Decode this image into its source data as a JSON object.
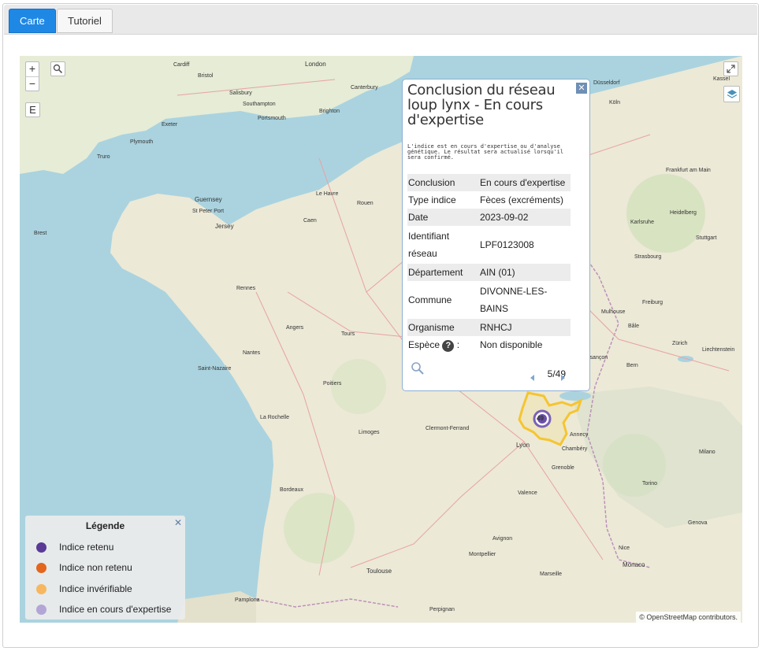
{
  "tabs": [
    {
      "label": "Carte",
      "active": true
    },
    {
      "label": "Tutoriel",
      "active": false
    }
  ],
  "map": {
    "controls": {
      "zoom_in": "+",
      "zoom_out": "−",
      "edit_label": "E"
    },
    "attribution": "© OpenStreetMap contributors.",
    "cluster_count": "49",
    "cities": [
      {
        "name": "London"
      },
      {
        "name": "Cardiff"
      },
      {
        "name": "Bristol"
      },
      {
        "name": "Salisbury"
      },
      {
        "name": "Southampton"
      },
      {
        "name": "Portsmouth"
      },
      {
        "name": "Canterbury"
      },
      {
        "name": "Brighton"
      },
      {
        "name": "Exeter"
      },
      {
        "name": "Plymouth"
      },
      {
        "name": "Truro"
      },
      {
        "name": "Guernsey"
      },
      {
        "name": "St Peter Port"
      },
      {
        "name": "Jersey"
      },
      {
        "name": "Rouen"
      },
      {
        "name": "Caen"
      },
      {
        "name": "Le Havre"
      },
      {
        "name": "Rennes"
      },
      {
        "name": "Nantes"
      },
      {
        "name": "Angers"
      },
      {
        "name": "Tours"
      },
      {
        "name": "Poitiers"
      },
      {
        "name": "La Rochelle"
      },
      {
        "name": "Bordeaux"
      },
      {
        "name": "Limoges"
      },
      {
        "name": "Clermont-Ferrand"
      },
      {
        "name": "Lyon"
      },
      {
        "name": "Grenoble"
      },
      {
        "name": "Toulouse"
      },
      {
        "name": "Montpellier"
      },
      {
        "name": "Marseille"
      },
      {
        "name": "Nice"
      },
      {
        "name": "Monaco"
      },
      {
        "name": "Genova"
      },
      {
        "name": "Milano"
      },
      {
        "name": "Torino"
      },
      {
        "name": "Zürich"
      },
      {
        "name": "Bern"
      },
      {
        "name": "Strasbourg"
      },
      {
        "name": "Frankfurt am Main"
      },
      {
        "name": "Köln"
      },
      {
        "name": "Düsseldorf"
      },
      {
        "name": "Freiburg"
      },
      {
        "name": "Karlsruhe"
      },
      {
        "name": "Stuttgart"
      },
      {
        "name": "Heidelberg"
      },
      {
        "name": "Pamplona"
      },
      {
        "name": "Annecy"
      },
      {
        "name": "Chambéry"
      },
      {
        "name": "Valence"
      },
      {
        "name": "Brest"
      },
      {
        "name": "Saint-Nazaire"
      },
      {
        "name": "Avignon"
      },
      {
        "name": "Mulhouse"
      },
      {
        "name": "Bâle"
      },
      {
        "name": "Besançon"
      },
      {
        "name": "Liechtenstein"
      },
      {
        "name": "Perpignan"
      },
      {
        "name": "Kassel"
      }
    ]
  },
  "popup": {
    "title": "Conclusion du réseau loup lynx - En cours d'expertise",
    "note": "L'indice est en cours d'expertise ou d'analyse génétique. Le résultat sera actualisé lorsqu'il sera confirmé.",
    "rows": [
      {
        "key": "Conclusion",
        "value": "En cours d'expertise"
      },
      {
        "key": "Type indice",
        "value": "Fèces (excréments)"
      },
      {
        "key": "Date",
        "value": "2023-09-02"
      },
      {
        "key": "Identifiant réseau",
        "value": "LPF0123008"
      },
      {
        "key": "Département",
        "value": "AIN (01)"
      },
      {
        "key": "Commune",
        "value": "DIVONNE-LES-BAINS"
      },
      {
        "key": "Organisme",
        "value": "RNHCJ"
      }
    ],
    "species_label": "Espèce",
    "species_suffix": " :",
    "species_help": "?",
    "species_value": "Non disponible",
    "pager": "5/49",
    "close": "✕"
  },
  "legend": {
    "title": "Légende",
    "close": "✕",
    "items": [
      {
        "label": "Indice retenu",
        "color": "#5a3a96"
      },
      {
        "label": "Indice non retenu",
        "color": "#e3661c"
      },
      {
        "label": "Indice invérifiable",
        "color": "#f7b760"
      },
      {
        "label": "Indice en cours d'expertise",
        "color": "#b3a6d6"
      }
    ]
  }
}
